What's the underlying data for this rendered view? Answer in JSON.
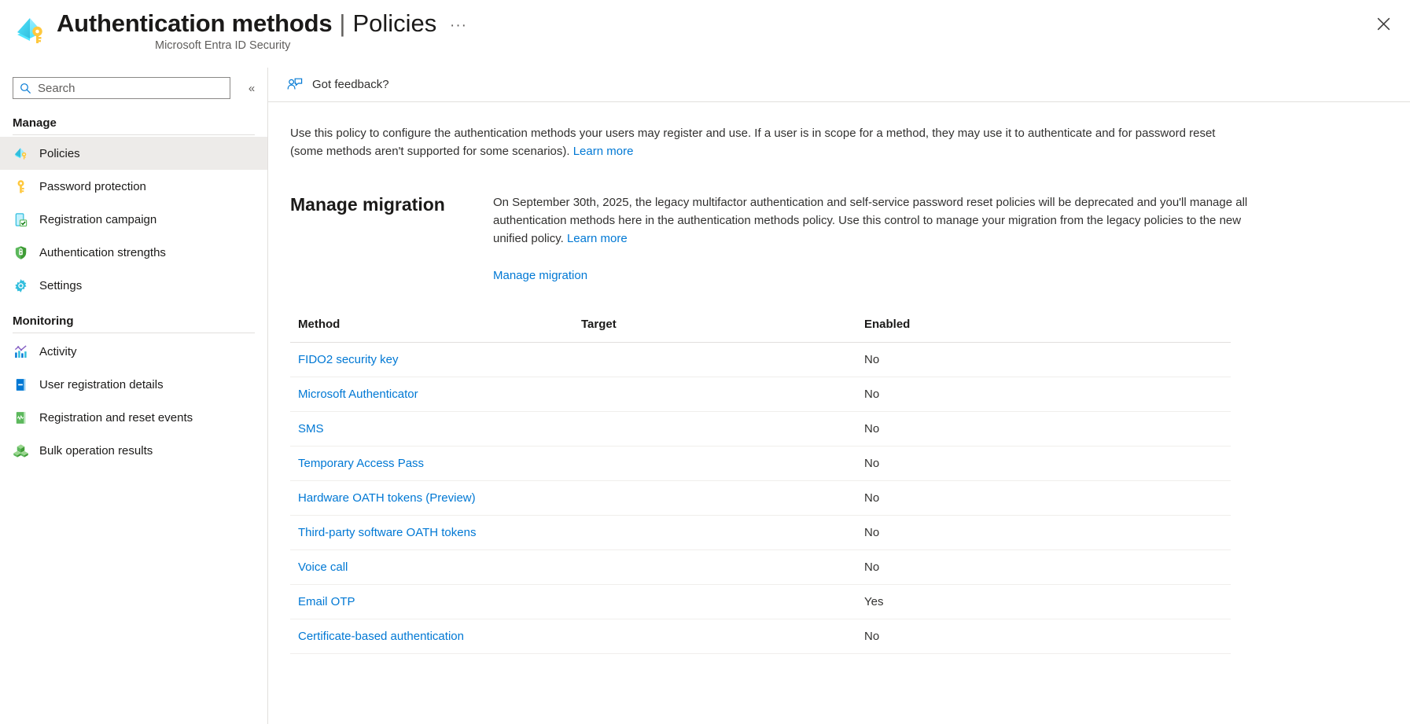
{
  "header": {
    "icon": "entra-auth-methods-icon",
    "title": "Authentication methods",
    "separator": "|",
    "tab": "Policies",
    "more_label": "···",
    "subtitle": "Microsoft Entra ID Security",
    "close_label": "close-icon"
  },
  "sidebar": {
    "search": {
      "placeholder": "Search",
      "value": "",
      "icon": "search-icon"
    },
    "collapse_label": "«",
    "groups": [
      {
        "title": "Manage",
        "items": [
          {
            "label": "Policies",
            "icon": "entra-auth-methods-icon",
            "selected": true
          },
          {
            "label": "Password protection",
            "icon": "key-icon",
            "selected": false
          },
          {
            "label": "Registration campaign",
            "icon": "mobile-check-icon",
            "selected": false
          },
          {
            "label": "Authentication strengths",
            "icon": "shield-lock-icon",
            "selected": false
          },
          {
            "label": "Settings",
            "icon": "gear-icon",
            "selected": false
          }
        ]
      },
      {
        "title": "Monitoring",
        "items": [
          {
            "label": "Activity",
            "icon": "chart-activity-icon",
            "selected": false
          },
          {
            "label": "User registration details",
            "icon": "blue-book-icon",
            "selected": false
          },
          {
            "label": "Registration and reset events",
            "icon": "green-book-icon",
            "selected": false
          },
          {
            "label": "Bulk operation results",
            "icon": "cubes-icon",
            "selected": false
          }
        ]
      }
    ]
  },
  "command_bar": {
    "feedback_label": "Got feedback?",
    "feedback_icon": "feedback-person-icon"
  },
  "main": {
    "intro": {
      "text": "Use this policy to configure the authentication methods your users may register and use. If a user is in scope for a method, they may use it to authenticate and for password reset (some methods aren't supported for some scenarios). ",
      "link_label": "Learn more"
    },
    "migration": {
      "heading": "Manage migration",
      "description": "On September 30th, 2025, the legacy multifactor authentication and self-service password reset policies will be deprecated and you'll manage all authentication methods here in the authentication methods policy. Use this control to manage your migration from the legacy policies to the new unified policy. ",
      "description_link_label": "Learn more",
      "action_link_label": "Manage migration"
    },
    "table": {
      "columns": [
        "Method",
        "Target",
        "Enabled"
      ],
      "rows": [
        {
          "method": "FIDO2 security key",
          "target": "",
          "enabled": "No"
        },
        {
          "method": "Microsoft Authenticator",
          "target": "",
          "enabled": "No"
        },
        {
          "method": "SMS",
          "target": "",
          "enabled": "No"
        },
        {
          "method": "Temporary Access Pass",
          "target": "",
          "enabled": "No"
        },
        {
          "method": "Hardware OATH tokens (Preview)",
          "target": "",
          "enabled": "No"
        },
        {
          "method": "Third-party software OATH tokens",
          "target": "",
          "enabled": "No"
        },
        {
          "method": "Voice call",
          "target": "",
          "enabled": "No"
        },
        {
          "method": "Email OTP",
          "target": "",
          "enabled": "Yes"
        },
        {
          "method": "Certificate-based authentication",
          "target": "",
          "enabled": "No"
        }
      ]
    }
  },
  "colors": {
    "link": "#0078d4",
    "selected_nav": "#edebe9",
    "border": "#e1dfdd",
    "text": "#323130"
  }
}
